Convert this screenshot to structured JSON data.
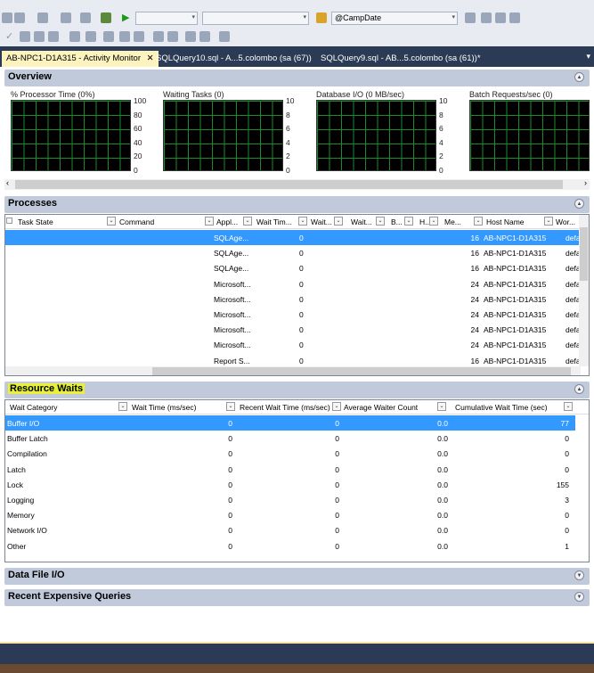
{
  "toolbar": {
    "combo1": "",
    "combo2": "",
    "param_combo": "@CampDate"
  },
  "tabs": [
    {
      "label": "AB-NPC1-D1A315 - Activity Monitor",
      "active": true,
      "close": "✕"
    },
    {
      "label": "SQLQuery10.sql - A...5.colombo (sa (67))"
    },
    {
      "label": "SQLQuery9.sql - AB...5.colombo (sa (61))*"
    }
  ],
  "overview": {
    "title": "Overview",
    "charts": [
      {
        "title": "% Processor Time (0%)",
        "ticks": [
          "100",
          "80",
          "60",
          "40",
          "20",
          "0"
        ]
      },
      {
        "title": "Waiting Tasks (0)",
        "ticks": [
          "10",
          "8",
          "6",
          "4",
          "2",
          "0"
        ]
      },
      {
        "title": "Database I/O (0 MB/sec)",
        "ticks": [
          "10",
          "8",
          "6",
          "4",
          "2",
          "0"
        ]
      },
      {
        "title": "Batch Requests/sec (0)",
        "ticks": []
      }
    ]
  },
  "processes": {
    "title": "Processes",
    "columns": [
      "Task State",
      "Command",
      "Appl...",
      "Wait Tim...",
      "Wait...",
      "Wait...",
      "B...",
      "H...",
      "Me...",
      "Host Name",
      "Wor..."
    ],
    "rows": [
      [
        "SQLAge...",
        "0",
        "16",
        "AB-NPC1-D1A315",
        "defa"
      ],
      [
        "SQLAge...",
        "0",
        "16",
        "AB-NPC1-D1A315",
        "defa"
      ],
      [
        "SQLAge...",
        "0",
        "16",
        "AB-NPC1-D1A315",
        "defa"
      ],
      [
        "Microsoft...",
        "0",
        "24",
        "AB-NPC1-D1A315",
        "defa"
      ],
      [
        "Microsoft...",
        "0",
        "24",
        "AB-NPC1-D1A315",
        "defa"
      ],
      [
        "Microsoft...",
        "0",
        "24",
        "AB-NPC1-D1A315",
        "defa"
      ],
      [
        "Microsoft...",
        "0",
        "24",
        "AB-NPC1-D1A315",
        "defa"
      ],
      [
        "Microsoft...",
        "0",
        "24",
        "AB-NPC1-D1A315",
        "defa"
      ],
      [
        "Report S...",
        "0",
        "16",
        "AB-NPC1-D1A315",
        "defa"
      ]
    ],
    "selected_row": 0
  },
  "resource_waits": {
    "title": "Resource Waits",
    "highlight_color": "#e8f03a",
    "columns": [
      "Wait Category",
      "Wait Time (ms/sec)",
      "Recent Wait Time (ms/sec)",
      "Average Waiter Count",
      "Cumulative Wait Time (sec)"
    ],
    "rows": [
      [
        "Buffer I/O",
        "0",
        "0",
        "0.0",
        "77"
      ],
      [
        "Buffer Latch",
        "0",
        "0",
        "0.0",
        "0"
      ],
      [
        "Compilation",
        "0",
        "0",
        "0.0",
        "0"
      ],
      [
        "Latch",
        "0",
        "0",
        "0.0",
        "0"
      ],
      [
        "Lock",
        "0",
        "0",
        "0.0",
        "155"
      ],
      [
        "Logging",
        "0",
        "0",
        "0.0",
        "3"
      ],
      [
        "Memory",
        "0",
        "0",
        "0.0",
        "0"
      ],
      [
        "Network I/O",
        "0",
        "0",
        "0.0",
        "0"
      ],
      [
        "Other",
        "0",
        "0",
        "0.0",
        "1"
      ]
    ],
    "selected_row": 0
  },
  "data_file_io": {
    "title": "Data File I/O"
  },
  "recent_expensive_queries": {
    "title": "Recent Expensive Queries"
  },
  "colors": {
    "selection": "#3399ff",
    "tab_strip": "#2b3a55",
    "panel_header": "#c1cadb",
    "active_tab": "#fdf3bf",
    "chart_grid": "#1f8a2c"
  }
}
